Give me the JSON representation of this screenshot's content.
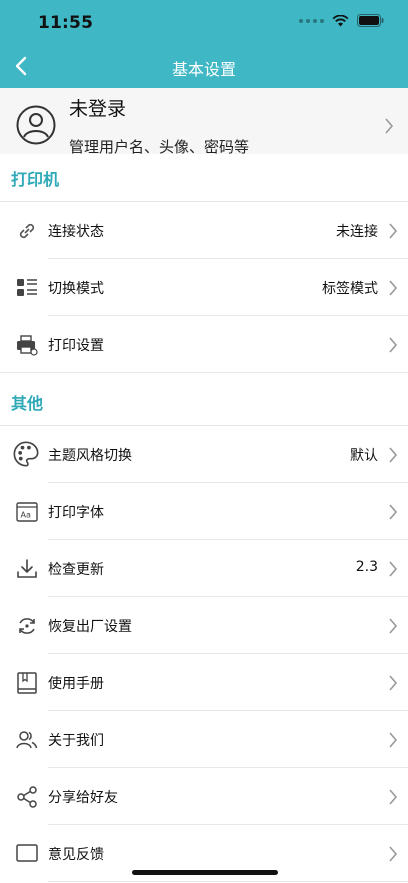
{
  "status": {
    "time": "11:55"
  },
  "nav": {
    "title": "基本设置"
  },
  "profile": {
    "name": "未登录",
    "desc": "管理用户名、头像、密码等"
  },
  "sections": [
    {
      "title": "打印机",
      "items": [
        {
          "label": "连接状态",
          "value": "未连接",
          "icon": "link-icon"
        },
        {
          "label": "切换模式",
          "value": "标签模式",
          "icon": "list-grid-icon"
        },
        {
          "label": "打印设置",
          "value": "",
          "icon": "printer-icon"
        }
      ]
    },
    {
      "title": "其他",
      "items": [
        {
          "label": "主题风格切换",
          "value": "默认",
          "icon": "palette-icon"
        },
        {
          "label": "打印字体",
          "value": "",
          "icon": "font-icon"
        },
        {
          "label": "检查更新",
          "value": "2.3",
          "icon": "download-icon"
        },
        {
          "label": "恢复出厂设置",
          "value": "",
          "icon": "reset-icon"
        },
        {
          "label": "使用手册",
          "value": "",
          "icon": "book-icon"
        },
        {
          "label": "关于我们",
          "value": "",
          "icon": "users-icon"
        },
        {
          "label": "分享给好友",
          "value": "",
          "icon": "share-icon"
        },
        {
          "label": "意见反馈",
          "value": "",
          "icon": "feedback-icon"
        }
      ]
    }
  ],
  "colors": {
    "accent": "#3fb7c4",
    "section_title": "#2fa9b8"
  }
}
